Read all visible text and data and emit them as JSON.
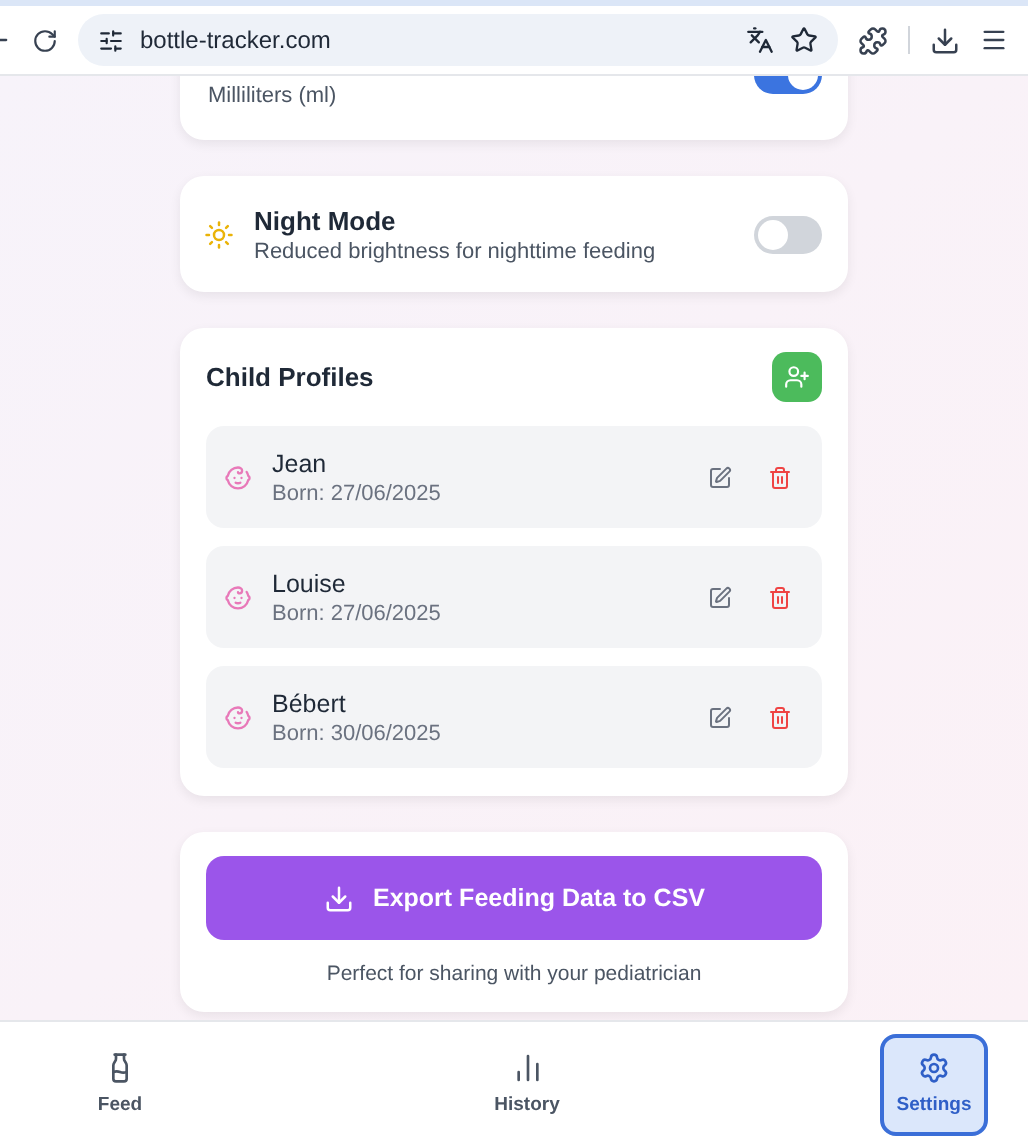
{
  "browser": {
    "url": "bottle-tracker.com"
  },
  "units_card": {
    "subtitle": "Milliliters (ml)",
    "on": true
  },
  "night_mode": {
    "title": "Night Mode",
    "subtitle": "Reduced brightness for nighttime feeding",
    "on": false
  },
  "child_profiles": {
    "title": "Child Profiles",
    "children": [
      {
        "name": "Jean",
        "born": "Born: 27/06/2025"
      },
      {
        "name": "Louise",
        "born": "Born: 27/06/2025"
      },
      {
        "name": "Bébert",
        "born": "Born: 30/06/2025"
      }
    ]
  },
  "export": {
    "button": "Export Feeding Data to CSV",
    "note": "Perfect for sharing with your pediatrician"
  },
  "nav": [
    {
      "kind": "feed",
      "label": "Feed",
      "selected": false
    },
    {
      "kind": "history",
      "label": "History",
      "selected": false
    },
    {
      "kind": "settings",
      "label": "Settings",
      "selected": true
    }
  ]
}
